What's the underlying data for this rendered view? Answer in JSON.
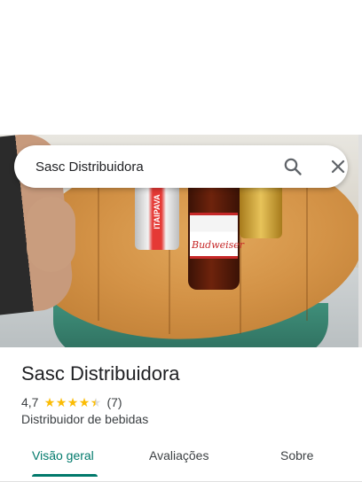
{
  "search": {
    "value": "Sasc Distribuidora"
  },
  "place": {
    "name": "Sasc Distribuidora",
    "rating": "4,7",
    "rating_stars": 4.7,
    "reviews_count": "(7)",
    "category": "Distribuidor de bebidas"
  },
  "photo": {
    "bottle_label": "Budweiser",
    "can_label": "ITAIPAVA"
  },
  "tabs": [
    {
      "label": "Visão geral",
      "active": true
    },
    {
      "label": "Avaliações",
      "active": false
    },
    {
      "label": "Sobre",
      "active": false
    }
  ],
  "colors": {
    "accent": "#00796b",
    "star": "#fbbc04",
    "text_primary": "#202124",
    "text_secondary": "#3c4043"
  },
  "icons": {
    "search": "search-icon",
    "close": "close-icon",
    "star": "star-icon"
  }
}
